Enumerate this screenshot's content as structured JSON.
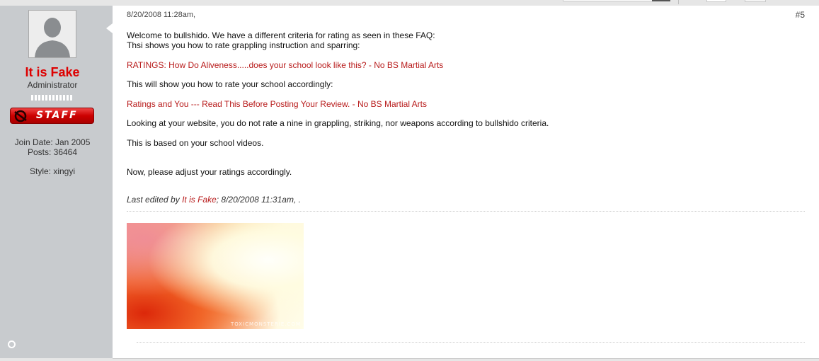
{
  "user": {
    "name": "It is Fake",
    "title": "Administrator",
    "badge": "STAFF",
    "join_date": "Join Date: Jan 2005",
    "posts": "Posts: 36464",
    "style": "Style: xingyi"
  },
  "post": {
    "date": "8/20/2008 11:28am,",
    "number": "#5",
    "lines": {
      "welcome": "Welcome to bullshido. We have a different criteria for rating as seen in these FAQ:",
      "thsi": "Thsi shows you how to rate grappling instruction and sparring:",
      "link1": "RATINGS: How Do Aliveness.....does your school look like this? - No BS Martial Arts",
      "this_will": "This will show you how to rate your school accordingly:",
      "link2": "Ratings and You --- Read This Before Posting Your Review. - No BS Martial Arts",
      "looking": "Looking at your website, you do not rate a nine in grappling, striking, nor weapons according to bullshido criteria.",
      "based": "This is based on your school videos.",
      "adjust": "Now, please adjust your ratings accordingly."
    },
    "edited": {
      "prefix": "Last edited by ",
      "user": "It is Fake",
      "suffix": "; 8/20/2008 11:31am, ."
    },
    "signature_text": "TOXICMONSTERIE.COM"
  },
  "colors": {
    "username": "#dd0000",
    "link": "#b81b1b",
    "sidebar": "#c8cbce"
  }
}
